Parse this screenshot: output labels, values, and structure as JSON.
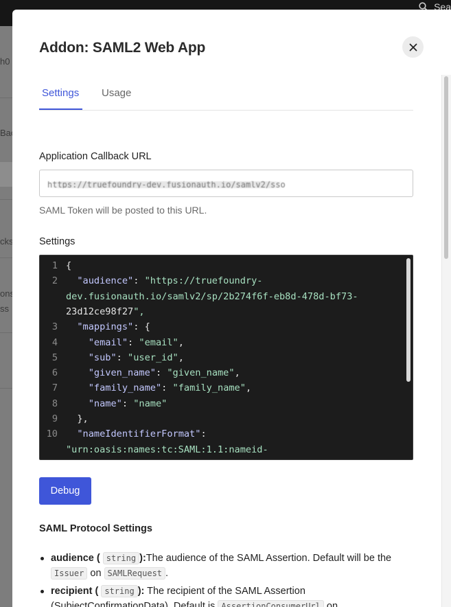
{
  "background": {
    "search_label": "Sea",
    "left_fragments": [
      "h0",
      "Bac",
      "cks",
      "ons",
      "ss"
    ]
  },
  "modal": {
    "title": "Addon: SAML2 Web App",
    "close_icon": "close-icon"
  },
  "tabs": [
    {
      "label": "Settings",
      "active": true
    },
    {
      "label": "Usage",
      "active": false
    }
  ],
  "callback": {
    "label": "Application Callback URL",
    "value": "https://truefoundry-dev.fusionauth.io/samlv2/sso",
    "helper": "SAML Token will be posted to this URL."
  },
  "settings": {
    "label": "Settings",
    "lines": [
      {
        "n": "1",
        "code": "{"
      },
      {
        "n": "2",
        "code": "  \"audience\": \"https://truefoundry-"
      },
      {
        "n": "",
        "code": "dev.fusionauth.io/samlv2/sp/2b274f6f-eb8d-478d-bf73-"
      },
      {
        "n": "",
        "code": "23d12ce98f27\","
      },
      {
        "n": "3",
        "code": "  \"mappings\": {"
      },
      {
        "n": "4",
        "code": "    \"email\": \"email\","
      },
      {
        "n": "5",
        "code": "    \"sub\": \"user_id\","
      },
      {
        "n": "6",
        "code": "    \"given_name\": \"given_name\","
      },
      {
        "n": "7",
        "code": "    \"family_name\": \"family_name\","
      },
      {
        "n": "8",
        "code": "    \"name\": \"name\""
      },
      {
        "n": "9",
        "code": "  },"
      },
      {
        "n": "10",
        "code": "  \"nameIdentifierFormat\":"
      },
      {
        "n": "",
        "code": "\"urn:oasis:names:tc:SAML:1.1:nameid-"
      }
    ]
  },
  "debug_button": "Debug",
  "protocol": {
    "title": "SAML Protocol Settings",
    "items": [
      {
        "name": "audience",
        "type": "string",
        "sep": "):",
        "text": "The audience of the SAML Assertion. Default will be the ",
        "code1": "Issuer",
        "mid": " on ",
        "code2": "SAMLRequest",
        "tail": "."
      },
      {
        "name": "recipient",
        "type": "string",
        "sep": "):",
        "text": " The recipient of the SAML Assertion (SubjectConfirmationData). Default is ",
        "code1": "AssertionConsumerUrl",
        "mid": " on ",
        "code2": "",
        "tail": ""
      }
    ]
  }
}
